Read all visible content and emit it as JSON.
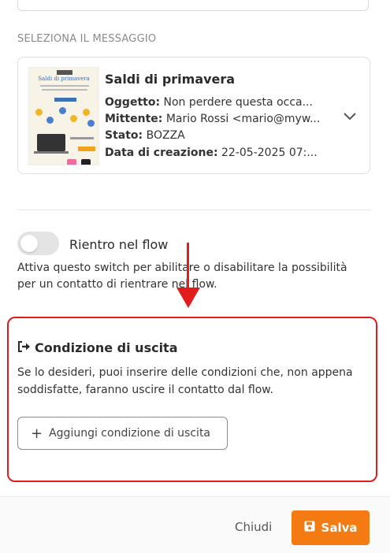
{
  "section_label": "SELEZIONA IL MESSAGGIO",
  "message": {
    "thumbnail_title": "Saldi di primavera",
    "title": "Saldi di primavera",
    "subject_label": "Oggetto:",
    "subject_value": "Non perdere questa occa...",
    "sender_label": "Mittente:",
    "sender_value": "Mario Rossi <mario@myw...",
    "status_label": "Stato:",
    "status_value": "BOZZA",
    "created_label": "Data di creazione:",
    "created_value": "22-05-2025 07:..."
  },
  "reentry": {
    "label": "Rientro nel flow",
    "help": "Attiva questo switch per abilitare o disabilitare la possibilità per un contatto di rientrare nel flow.",
    "enabled": false
  },
  "exit_condition": {
    "title": "Condizione di uscita",
    "help": "Se lo desideri, puoi inserire delle condizioni che, non appena soddisfatte, faranno uscire il contatto dal flow.",
    "add_button": "Aggiungi condizione di uscita"
  },
  "footer": {
    "close_label": "Chiudi",
    "save_label": "Salva"
  },
  "colors": {
    "accent": "#f47b12",
    "annotation": "#e01c1c"
  }
}
